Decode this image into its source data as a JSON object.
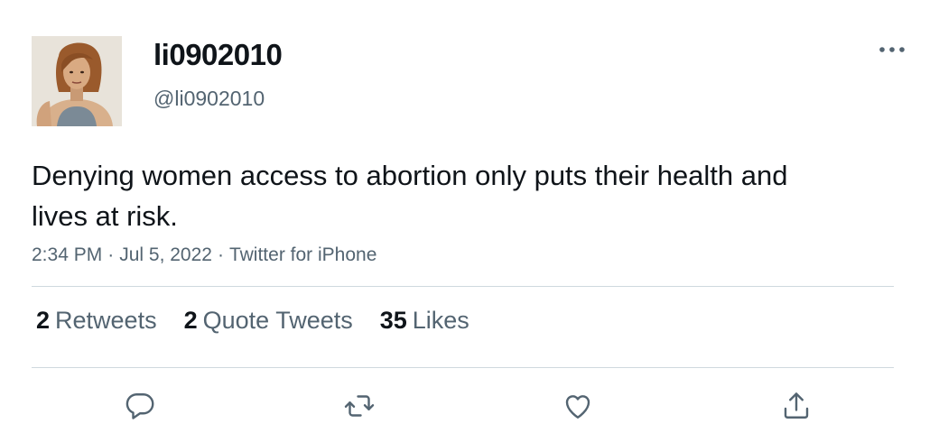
{
  "user": {
    "display_name": "li0902010",
    "handle": "@li0902010"
  },
  "tweet": {
    "text": "Denying women access to abortion only puts their health and lives at risk.",
    "time": "2:34 PM",
    "date": "Jul 5, 2022",
    "source": "Twitter for iPhone",
    "separator": "·"
  },
  "stats": [
    {
      "count": "2",
      "label": "Retweets"
    },
    {
      "count": "2",
      "label": "Quote Tweets"
    },
    {
      "count": "35",
      "label": "Likes"
    }
  ],
  "icons": {
    "more": "more-horizontal-icon",
    "reply": "reply-icon",
    "retweet": "retweet-icon",
    "like": "heart-icon",
    "share": "share-icon"
  },
  "colors": {
    "text_primary": "#0f1419",
    "text_secondary": "#536471",
    "divider": "#cfd9de"
  }
}
